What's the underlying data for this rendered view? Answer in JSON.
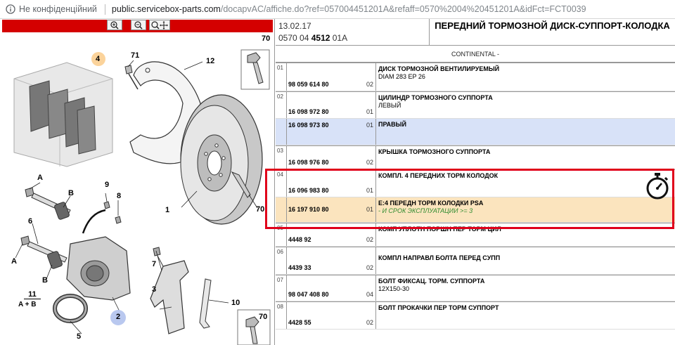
{
  "browser": {
    "security_label": "Не конфіденційний",
    "url_host": "public.servicebox-parts.com",
    "url_path": "/docapvAC/affiche.do?ref=057004451201A&refaff=0570%2004%20451201A&idFct=FCT0039"
  },
  "diagram": {
    "labels": [
      "70",
      "71",
      "12",
      "4",
      "1",
      "70",
      "9",
      "8",
      "A",
      "B",
      "6",
      "A",
      "B",
      "11",
      "A + B",
      "5",
      "7",
      "3",
      "10",
      "2",
      "70"
    ]
  },
  "header": {
    "date": "13.02.17",
    "ref_prefix": "0570 04 ",
    "ref_bold": "4512",
    "ref_suffix": " 01A",
    "title": "ПЕРЕДНИЙ ТОРМОЗНОЙ ДИСК-СУППОРТ-КОЛОДКА",
    "supplier": "CONTINENTAL -"
  },
  "rows": [
    {
      "idx": "01",
      "ref": "98 059 614 80",
      "qty": "02",
      "desc": "ДИСК ТОРМОЗНОЙ ВЕНТИЛИРУЕМЫЙ",
      "sub": "DIAM 283 EP 26"
    },
    {
      "idx": "02",
      "ref": "16 098 972 80",
      "qty": "01",
      "desc": "ЦИЛИНДР ТОРМОЗНОГО СУППОРТА",
      "sub": "ЛЕВЫЙ"
    },
    {
      "idx": "",
      "ref": "16 098 973 80",
      "qty": "01",
      "desc": "ПРАВЫЙ",
      "sub": ""
    },
    {
      "idx": "03",
      "ref": "16 098 976 80",
      "qty": "02",
      "desc": "КРЫШКА ТОРМОЗНОГО СУППОРТА",
      "sub": ""
    },
    {
      "idx": "04",
      "ref": "16 096 983 80",
      "qty": "01",
      "desc": "КОМПЛ. 4 ПЕРЕДНИХ ТОРМ КОЛОДОК",
      "sub": ""
    },
    {
      "idx": "",
      "ref": "16 197 910 80",
      "qty": "01",
      "desc": "E:4 ПЕРЕДН ТОРМ КОЛОДКИ PSA",
      "sub": "- И СРОК ЭКСПЛУАТАЦИИ >= 3"
    },
    {
      "idx": "05",
      "ref": "4448 92",
      "qty": "02",
      "desc": "КОМП УПЛОТН ПОРШН ПЕР ТОРМ ЦИЛ",
      "sub": ""
    },
    {
      "idx": "06",
      "ref": "4439 33",
      "qty": "02",
      "desc": "КОМПЛ НАПРАВЛ БОЛТА ПЕРЕД СУПП",
      "sub": ""
    },
    {
      "idx": "07",
      "ref": "98 047 408 80",
      "qty": "04",
      "desc": "БОЛТ ФИКСАЦ. ТОРМ. СУППОРТА",
      "sub": "12X150-30"
    },
    {
      "idx": "08",
      "ref": "4428 55",
      "qty": "02",
      "desc": "БОЛТ ПРОКАЧКИ ПЕР ТОРМ СУППОРТ",
      "sub": ""
    }
  ],
  "icons": {
    "zoom_in": "zoom-in-icon",
    "zoom_out": "zoom-out-icon",
    "pan": "pan-icon",
    "labour_time": "stopwatch-icon"
  },
  "colors": {
    "toolbar_red": "#d40000",
    "row_blue": "#d8e2f8",
    "row_orange": "#fbe4be",
    "highlight_red": "#e0001a",
    "sub_green": "#2f8b2f"
  }
}
